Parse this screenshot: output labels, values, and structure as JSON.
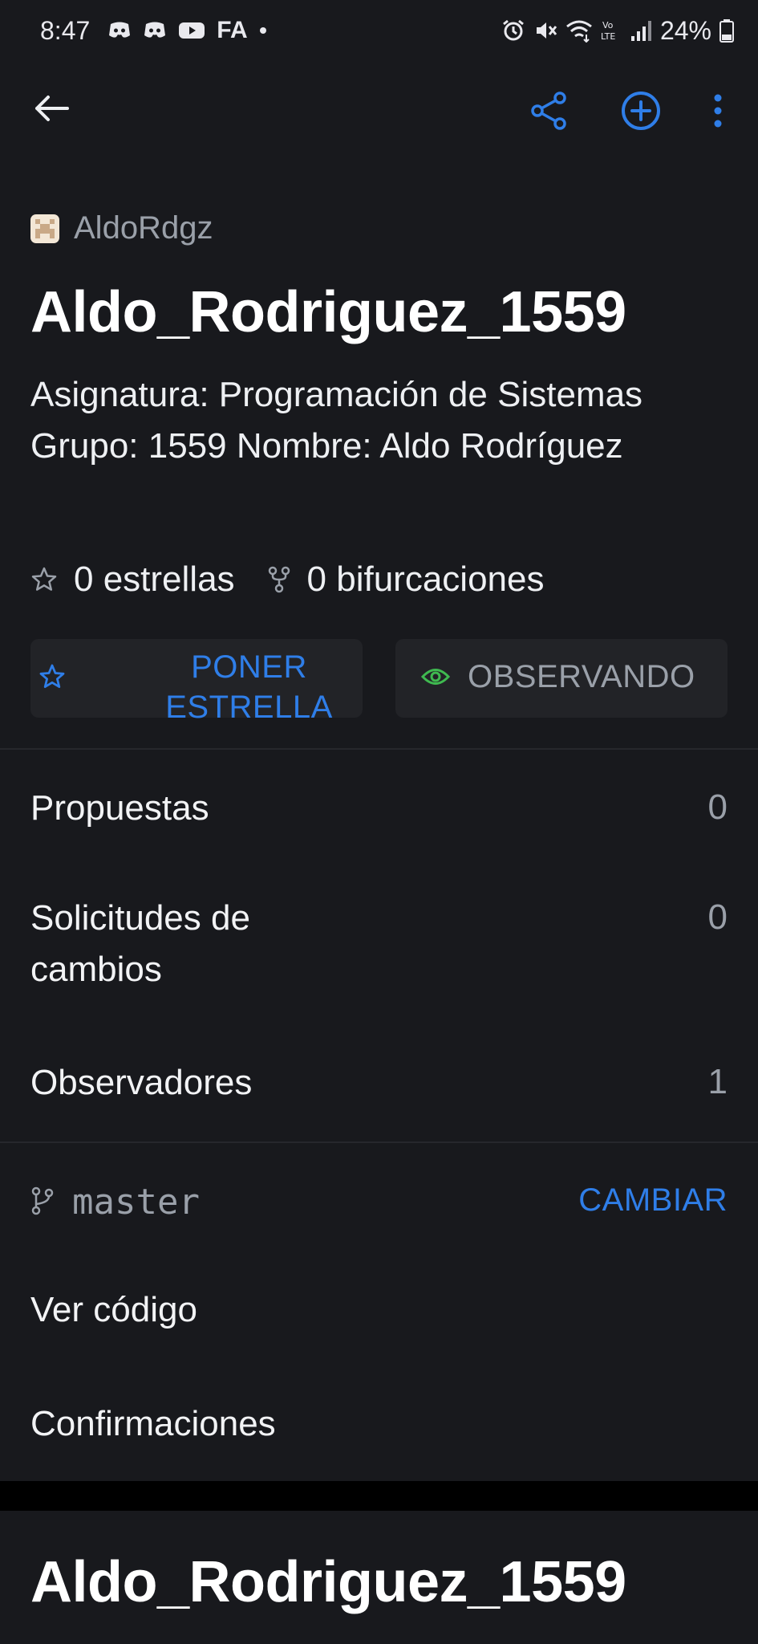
{
  "status_bar": {
    "time": "8:47",
    "left_icons": [
      "discord-icon",
      "discord-icon",
      "youtube-icon",
      "fa-icon",
      "dot-icon"
    ],
    "fa_label": "FA",
    "right_icons": [
      "alarm-icon",
      "mute-icon",
      "wifi-icon",
      "volte-icon",
      "signal-icon",
      "battery-icon"
    ],
    "battery": "24%"
  },
  "app_bar": {
    "actions": [
      "back-arrow-icon",
      "share-icon",
      "add-circle-icon",
      "more-vertical-icon"
    ]
  },
  "repo": {
    "owner": "AldoRdgz",
    "name": "Aldo_Rodriguez_1559",
    "description": "Asignatura: Programación de Sistemas Grupo: 1559 Nombre: Aldo Rodríguez",
    "stars_label": "0 estrellas",
    "forks_label": "0 bifurcaciones"
  },
  "buttons": {
    "star_line1": "PONER",
    "star_line2": "ESTRELLA",
    "watch": "OBSERVANDO"
  },
  "rows": {
    "issues": {
      "label": "Propuestas",
      "count": "0"
    },
    "pulls": {
      "label_line1": "Solicitudes de",
      "label_line2": "cambios",
      "count": "0"
    },
    "watchers": {
      "label": "Observadores",
      "count": "1"
    }
  },
  "branch": {
    "name": "master",
    "change_label": "CAMBIAR"
  },
  "nav": {
    "code": "Ver código",
    "commits": "Confirmaciones"
  },
  "readme": {
    "title": "Aldo_Rodriguez_1559"
  },
  "colors": {
    "background": "#18191d",
    "accent": "#2f7ee8",
    "watch_icon": "#3fb950",
    "muted": "#9aa0a9"
  }
}
